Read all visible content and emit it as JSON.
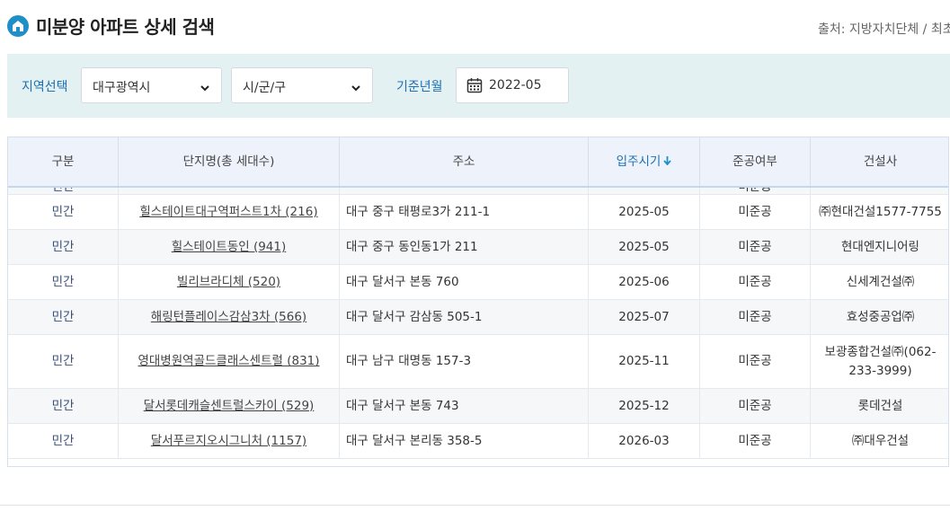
{
  "header": {
    "title": "미분양 아파트 상세 검색",
    "source": "출처: 지방자치단체 / 최초"
  },
  "filters": {
    "region_label": "지역선택",
    "region_value": "대구광역시",
    "district_value": "시/군/구",
    "date_label": "기준년월",
    "date_value": "2022-05"
  },
  "table": {
    "columns": [
      "구분",
      "단지명(총 세대수)",
      "주소",
      "입주시기",
      "준공여부",
      "건설사"
    ],
    "partial_row": [
      "민간",
      "",
      "",
      "",
      "미준공",
      ""
    ],
    "rows": [
      [
        "민간",
        "힐스테이트대구역퍼스트1차 (216)",
        "대구 중구 태평로3가 211-1",
        "2025-05",
        "미준공",
        "㈜현대건설1577-7755"
      ],
      [
        "민간",
        "힐스테이트동인 (941)",
        "대구 중구 동인동1가 211",
        "2025-05",
        "미준공",
        "현대엔지니어링"
      ],
      [
        "민간",
        "빌리브라디체 (520)",
        "대구 달서구 본동 760",
        "2025-06",
        "미준공",
        "신세계건설㈜"
      ],
      [
        "민간",
        "해링턴플레이스감삼3차 (566)",
        "대구 달서구 감삼동 505-1",
        "2025-07",
        "미준공",
        "효성중공업㈜"
      ],
      [
        "민간",
        "영대병원역골드클래스센트럴 (831)",
        "대구 남구 대명동 157-3",
        "2025-11",
        "미준공",
        "보광종합건설㈜(062-233-3999)"
      ],
      [
        "민간",
        "달서롯데캐슬센트럴스카이 (529)",
        "대구 달서구 본동 743",
        "2025-12",
        "미준공",
        "롯데건설"
      ],
      [
        "민간",
        "달서푸르지오시그니처 (1157)",
        "대구 달서구 본리동 358-5",
        "2026-03",
        "미준공",
        "㈜대우건설"
      ]
    ]
  },
  "colors": {
    "accent": "#1f8fc8",
    "filter_bg": "#e3f1f2",
    "label_blue": "#1f6fb1",
    "header_bg": "#eef3fb"
  },
  "icons": [
    "home-icon",
    "chevron-down-icon",
    "calendar-icon",
    "sort-down-arrow-icon"
  ]
}
